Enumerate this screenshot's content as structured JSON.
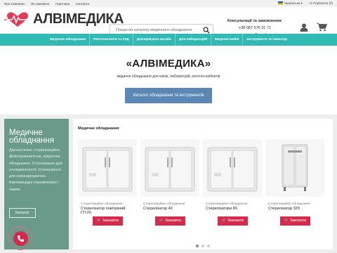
{
  "topbar": {
    "links": [
      "Про компанію",
      "Як замовити",
      "Партнери",
      "Контакти"
    ],
    "language": "Українська",
    "compare": "Порівняти (0)"
  },
  "header": {
    "brand": "АЛВІМЕДИКА",
    "search_placeholder": "Пошук по каталогу медичного обладнання",
    "contacts_title": "Консультації та замовлення:",
    "phone": "+38 067 576 31 71",
    "callback": "зворотний дзвінок"
  },
  "nav": [
    "Медичне обладнання",
    "Рентгенологія та УЗД",
    "Дезінфікуючі засоби",
    "Для лабораторій",
    "Медичні меблі",
    "Інструменти та інвентар"
  ],
  "hero": {
    "title": "«АЛВІМЕДИКА»",
    "subtitle": "медичне обладнання для клінік, лабораторій, рентген-кабінетів",
    "button": "Каталог обладнання та інструментів"
  },
  "promo": {
    "title_line1": "Медичне",
    "title_line2": "обладнання",
    "description": "Діагностичне, стерилізаційне, фізіотерапевтичне, хірургічне обладнання. Устаткування для отоларингології. Устаткування для новонароджених. Бактерицидні опромінювачі і лампи.",
    "button": "Каталог"
  },
  "products": {
    "section_title": "Медичне обладнання",
    "order_label": "Замовити",
    "items": [
      {
        "category": "Стерилізаційне обладнання",
        "name_line1": "Стерилізатор повітряний",
        "name_line2": "ГП-20"
      },
      {
        "category": "Стерилізаційне обладнання",
        "name_line1": "Стерилізатор 40",
        "name_line2": ""
      },
      {
        "category": "Стерилізаційне обладнання",
        "name_line1": "Стерилізатори 80",
        "name_line2": ""
      },
      {
        "category": "Стерилізаційне обладнання",
        "name_line1": "Стерилізатор 320",
        "name_line2": ""
      }
    ],
    "carousel_dots": 3,
    "active_dot": 1
  },
  "colors": {
    "accent": "#31b9b4",
    "brand_red": "#d62a4d",
    "promo_bg": "#6a9a8a",
    "hero_button": "#5b87b5"
  }
}
